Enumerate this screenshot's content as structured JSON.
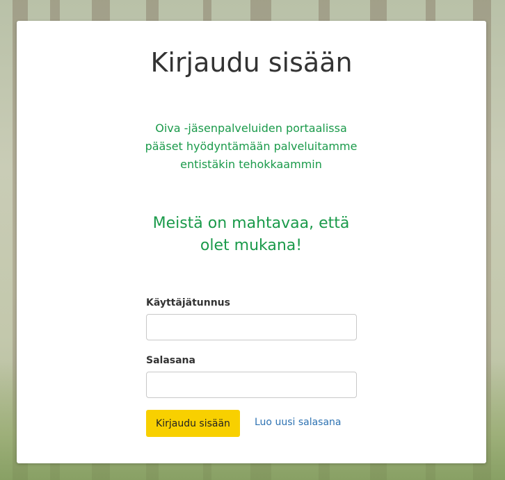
{
  "login": {
    "title": "Kirjaudu sisään",
    "intro": "Oiva -jäsenpalveluiden portaalissa pääset hyödyntämään palveluitamme entistäkin tehokkaammin",
    "tagline": "Meistä on mahtavaa, että olet mukana!",
    "username_label": "Käyttäjätunnus",
    "username_value": "",
    "password_label": "Salasana",
    "password_value": "",
    "submit_label": "Kirjaudu sisään",
    "reset_link_label": "Luo uusi salasana"
  },
  "colors": {
    "accent_green": "#1a9a4a",
    "button_yellow": "#f8d000",
    "link_blue": "#2d72b2"
  }
}
